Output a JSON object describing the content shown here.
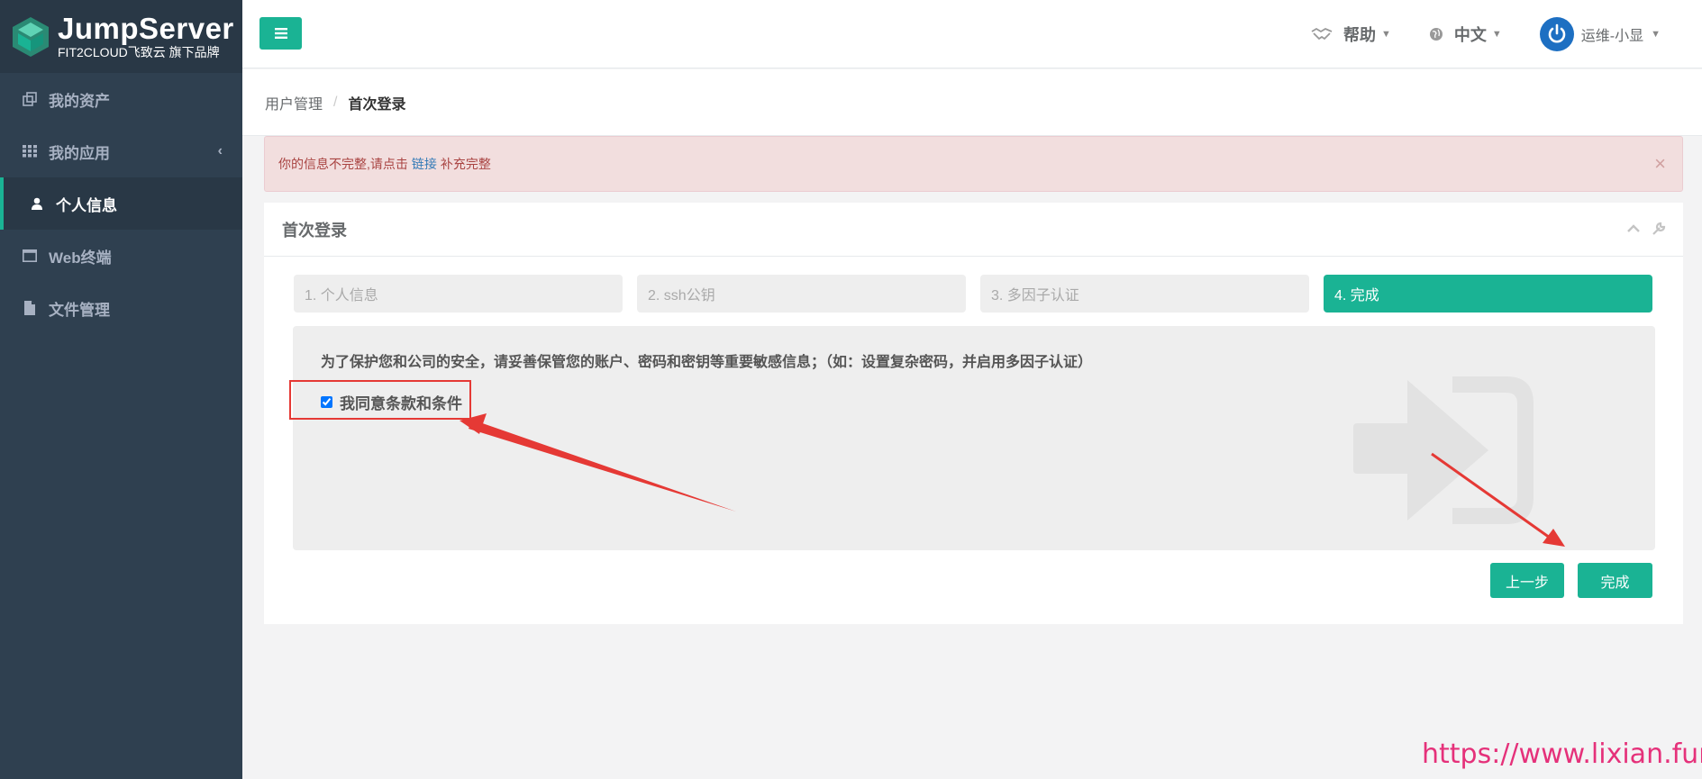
{
  "brand": {
    "name": "JumpServer",
    "subtitle": "FIT2CLOUD飞致云 旗下品牌"
  },
  "sidebar": {
    "items": [
      {
        "label": "我的资产",
        "icon": "assets-icon"
      },
      {
        "label": "我的应用",
        "icon": "grid-icon"
      },
      {
        "label": "个人信息",
        "icon": "user-icon",
        "active": true
      },
      {
        "label": "Web终端",
        "icon": "window-icon"
      },
      {
        "label": "文件管理",
        "icon": "file-icon"
      }
    ]
  },
  "topbar": {
    "help_label": "帮助",
    "lang_label": "中文",
    "user_label": "运维-小显"
  },
  "breadcrumb": {
    "parent": "用户管理",
    "current": "首次登录"
  },
  "alert": {
    "text_before": "你的信息不完整,请点击",
    "link_text": "链接",
    "text_after": "补充完整",
    "close_symbol": "×"
  },
  "panel": {
    "title": "首次登录",
    "steps": [
      {
        "label": "1. 个人信息"
      },
      {
        "label": "2. ssh公钥"
      },
      {
        "label": "3. 多因子认证"
      },
      {
        "label": "4. 完成",
        "current": true
      }
    ],
    "notice": "为了保护您和公司的安全，请妥善保管您的账户、密码和密钥等重要敏感信息；（如：设置复杂密码，并启用多因子认证）",
    "agree_label": "我同意条款和条件",
    "agree_checked": true,
    "prev_button": "上一步",
    "finish_button": "完成"
  },
  "colors": {
    "accent": "#1ab394",
    "sidebar_bg": "#2f4050",
    "alert_bg": "#f2dede",
    "annotation_red": "#e53935",
    "watermark": "#e5317a"
  },
  "watermark": "https://www.lixian.fun"
}
